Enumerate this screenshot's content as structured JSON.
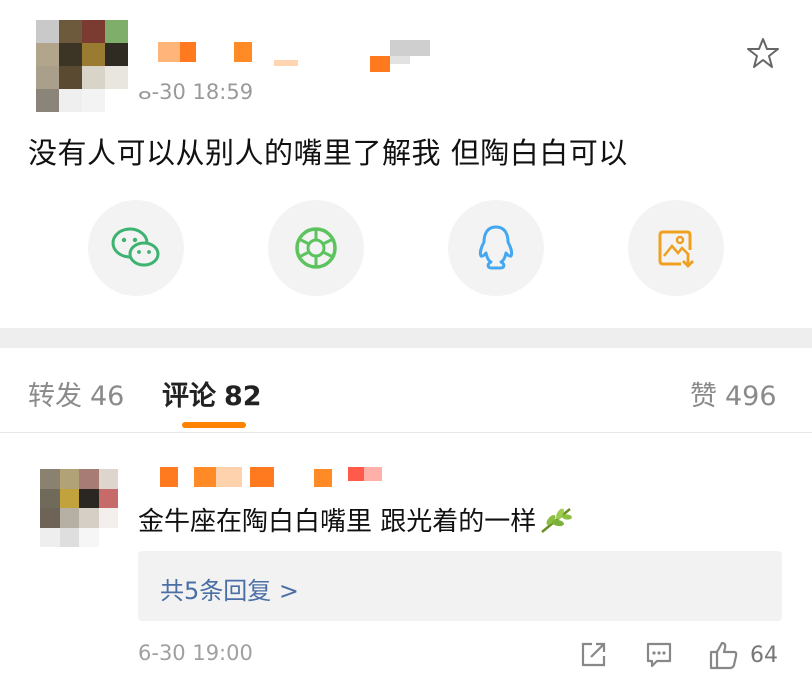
{
  "post": {
    "time": "ⴰ-30 18:59",
    "text": "没有人可以从别人的嘴里了解我 但陶白白可以",
    "share": [
      {
        "name": "wechat-icon",
        "color": "#3cb371"
      },
      {
        "name": "moments-icon",
        "color": "#5cc35f"
      },
      {
        "name": "qq-icon",
        "color": "#44a8f0"
      },
      {
        "name": "save-image-icon",
        "color": "#f0a020"
      }
    ]
  },
  "tabs": {
    "repost": {
      "label": "转发",
      "count": "46"
    },
    "comment": {
      "label": "评论",
      "count": "82"
    },
    "like": {
      "label": "赞",
      "count": "496"
    }
  },
  "comment": {
    "text": "金牛座在陶白白嘴里 跟光着的一样",
    "reply_link": "共5条回复 >",
    "time": "6-30 19:00",
    "like_count": "64"
  },
  "colors": {
    "accent": "#ff8200",
    "link": "#4a6fa5",
    "separator": "#eeeeee"
  }
}
